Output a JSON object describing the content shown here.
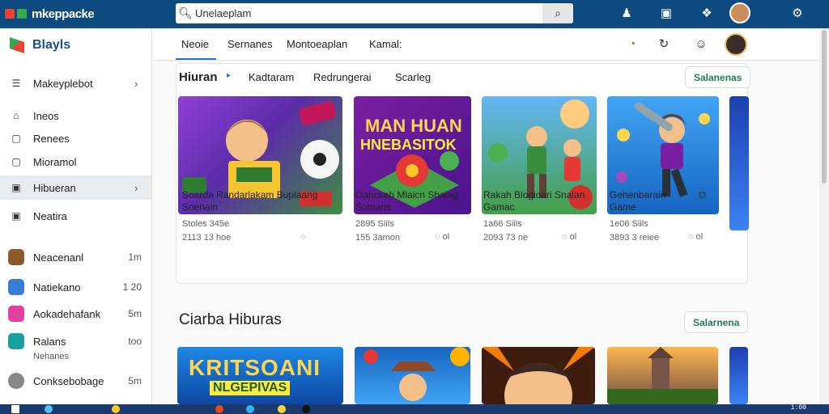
{
  "header": {
    "logo_text": "mkeppacke",
    "search_value": "Unelaeplam",
    "search_placeholder": "Unelaeplam"
  },
  "sidebar": {
    "brand": "Blayls",
    "items": [
      {
        "label": "Makeyplebot",
        "icon": "grid-icon",
        "arrow": "›"
      },
      {
        "label": "Ineos",
        "icon": "home-icon"
      },
      {
        "label": "Renees",
        "icon": "square-icon"
      },
      {
        "label": "Mioramol",
        "icon": "square-icon"
      },
      {
        "label": "Hibueran",
        "icon": "square-icon",
        "arrow": "›",
        "active": true
      },
      {
        "label": "Neatira",
        "icon": "square-icon"
      }
    ],
    "apps": [
      {
        "label": "Neacenanl",
        "meta": "1m",
        "color": "#8b5a2b"
      },
      {
        "label": "Natiekano",
        "meta": "1 20",
        "color": "#3a7bd5"
      },
      {
        "label": "Aokadehafank",
        "meta": "5m",
        "color": "#e040a0"
      },
      {
        "label": "Ralans",
        "meta": "too",
        "color": "#1aa0a0"
      },
      {
        "label": "Conksebobage",
        "meta": "5m",
        "color": "#888888"
      }
    ],
    "ralans_sub": "Nehanes"
  },
  "tabs": [
    "Neoie",
    "Sernanes",
    "Montoeaplan",
    "Kamal:"
  ],
  "section1": {
    "title": "Hiuran",
    "filters": [
      "Kadtaram",
      "Redrungerai",
      "Scarleg"
    ],
    "button": "Salanenas"
  },
  "games": [
    {
      "title_1": "Soarda Randarlakam Buplaang",
      "title_2": "Snenain",
      "meta_1": "Stoles 345e",
      "meta_2": "2113 13 hoe",
      "c1": "#7b3fc4",
      "c2": "#4caf50"
    },
    {
      "title_1": "Oahckah Mlaicn Shaiag",
      "title_2": "Somans",
      "meta_1": "2895 Siils",
      "meta_2": "155 3amon",
      "c1": "#6a1b9a",
      "c2": "#e53935"
    },
    {
      "title_1": "Rakah Blogioari Snalan",
      "title_2": "Gamac",
      "meta_1": "1a66 Siils",
      "meta_2": "2093 73 ne",
      "c1": "#1e88e5",
      "c2": "#43a047"
    },
    {
      "title_1": "Gehenbarain",
      "title_2": "Game",
      "meta_1": "1e06 Siils",
      "meta_2": "3893 3 reiee",
      "c1": "#1565c0",
      "c2": "#fbc02d"
    }
  ],
  "section2": {
    "title": "Ciarba Hiburas",
    "button": "Salarnena",
    "banner_text_1": "KRITSOANI",
    "banner_text_2": "NLGEPIVAS"
  },
  "taskbar": {
    "time": "1:00"
  }
}
